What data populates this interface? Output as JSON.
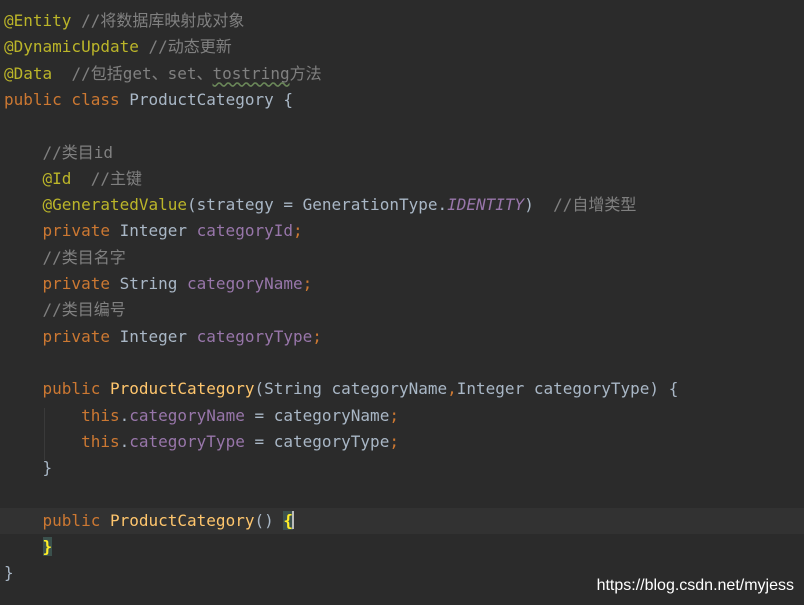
{
  "editor": {
    "lines": [
      {
        "indent": "",
        "tokens": [
          {
            "cls": "ann",
            "text": "@Entity"
          },
          {
            "cls": "plain",
            "text": " "
          },
          {
            "cls": "cmt",
            "text": "//将数据库映射成对象"
          }
        ]
      },
      {
        "indent": "",
        "tokens": [
          {
            "cls": "ann",
            "text": "@DynamicUpdate"
          },
          {
            "cls": "plain",
            "text": " "
          },
          {
            "cls": "cmt",
            "text": "//动态更新"
          }
        ]
      },
      {
        "indent": "",
        "tokens": [
          {
            "cls": "ann",
            "text": "@Data"
          },
          {
            "cls": "plain",
            "text": "  "
          },
          {
            "cls": "cmt",
            "text": "//包括get、set、"
          },
          {
            "cls": "cmt wavy",
            "text": "tostring"
          },
          {
            "cls": "cmt",
            "text": "方法"
          }
        ]
      },
      {
        "indent": "",
        "tokens": [
          {
            "cls": "kw",
            "text": "public class "
          },
          {
            "cls": "plain",
            "text": "ProductCategory {"
          }
        ]
      },
      {
        "indent": "",
        "tokens": []
      },
      {
        "indent": "    ",
        "tokens": [
          {
            "cls": "cmt",
            "text": "//类目id"
          }
        ]
      },
      {
        "indent": "    ",
        "tokens": [
          {
            "cls": "ann",
            "text": "@Id"
          },
          {
            "cls": "plain",
            "text": "  "
          },
          {
            "cls": "cmt",
            "text": "//主键"
          }
        ]
      },
      {
        "indent": "    ",
        "tokens": [
          {
            "cls": "ann",
            "text": "@GeneratedValue"
          },
          {
            "cls": "plain",
            "text": "(strategy = GenerationType."
          },
          {
            "cls": "fldi",
            "text": "IDENTITY"
          },
          {
            "cls": "plain",
            "text": ")  "
          },
          {
            "cls": "cmt",
            "text": "//自增类型"
          }
        ]
      },
      {
        "indent": "    ",
        "tokens": [
          {
            "cls": "kw",
            "text": "private "
          },
          {
            "cls": "plain",
            "text": "Integer "
          },
          {
            "cls": "fld",
            "text": "categoryId"
          },
          {
            "cls": "kw",
            "text": ";"
          }
        ]
      },
      {
        "indent": "    ",
        "tokens": [
          {
            "cls": "cmt",
            "text": "//类目名字"
          }
        ]
      },
      {
        "indent": "    ",
        "tokens": [
          {
            "cls": "kw",
            "text": "private "
          },
          {
            "cls": "plain",
            "text": "String "
          },
          {
            "cls": "fld",
            "text": "categoryName"
          },
          {
            "cls": "kw",
            "text": ";"
          }
        ]
      },
      {
        "indent": "    ",
        "tokens": [
          {
            "cls": "cmt",
            "text": "//类目编号"
          }
        ]
      },
      {
        "indent": "    ",
        "tokens": [
          {
            "cls": "kw",
            "text": "private "
          },
          {
            "cls": "plain",
            "text": "Integer "
          },
          {
            "cls": "fld",
            "text": "categoryType"
          },
          {
            "cls": "kw",
            "text": ";"
          }
        ]
      },
      {
        "indent": "",
        "tokens": []
      },
      {
        "indent": "    ",
        "tokens": [
          {
            "cls": "kw",
            "text": "public "
          },
          {
            "cls": "fn",
            "text": "ProductCategory"
          },
          {
            "cls": "plain",
            "text": "(String categoryName"
          },
          {
            "cls": "kw",
            "text": ","
          },
          {
            "cls": "plain",
            "text": "Integer categoryType) {"
          }
        ]
      },
      {
        "indent": "        ",
        "tokens": [
          {
            "cls": "kw",
            "text": "this"
          },
          {
            "cls": "plain",
            "text": "."
          },
          {
            "cls": "fld",
            "text": "categoryName"
          },
          {
            "cls": "plain",
            "text": " = categoryName"
          },
          {
            "cls": "kw",
            "text": ";"
          }
        ]
      },
      {
        "indent": "        ",
        "tokens": [
          {
            "cls": "kw",
            "text": "this"
          },
          {
            "cls": "plain",
            "text": "."
          },
          {
            "cls": "fld",
            "text": "categoryType"
          },
          {
            "cls": "plain",
            "text": " = categoryType"
          },
          {
            "cls": "kw",
            "text": ";"
          }
        ]
      },
      {
        "indent": "    ",
        "tokens": [
          {
            "cls": "plain",
            "text": "}"
          }
        ]
      },
      {
        "indent": "",
        "tokens": []
      },
      {
        "indent": "    ",
        "current": true,
        "tokens": [
          {
            "cls": "kw",
            "text": "public "
          },
          {
            "cls": "fn",
            "text": "ProductCategory"
          },
          {
            "cls": "plain",
            "text": "() "
          },
          {
            "cls": "brace-hl",
            "text": "{"
          },
          {
            "cls": "caret",
            "text": ""
          }
        ]
      },
      {
        "indent": "    ",
        "tokens": [
          {
            "cls": "brace-hl",
            "text": "}"
          }
        ]
      },
      {
        "indent": "",
        "tokens": [
          {
            "cls": "plain",
            "text": "}"
          }
        ]
      }
    ]
  },
  "watermark": {
    "text": "https://blog.csdn.net/myjess"
  },
  "colors": {
    "background": "#2b2b2b",
    "current_line": "#323232",
    "annotation": "#bbb529",
    "comment": "#808080",
    "keyword": "#cc7832",
    "field": "#9876aa",
    "method": "#ffc66d",
    "text": "#a9b7c6"
  }
}
